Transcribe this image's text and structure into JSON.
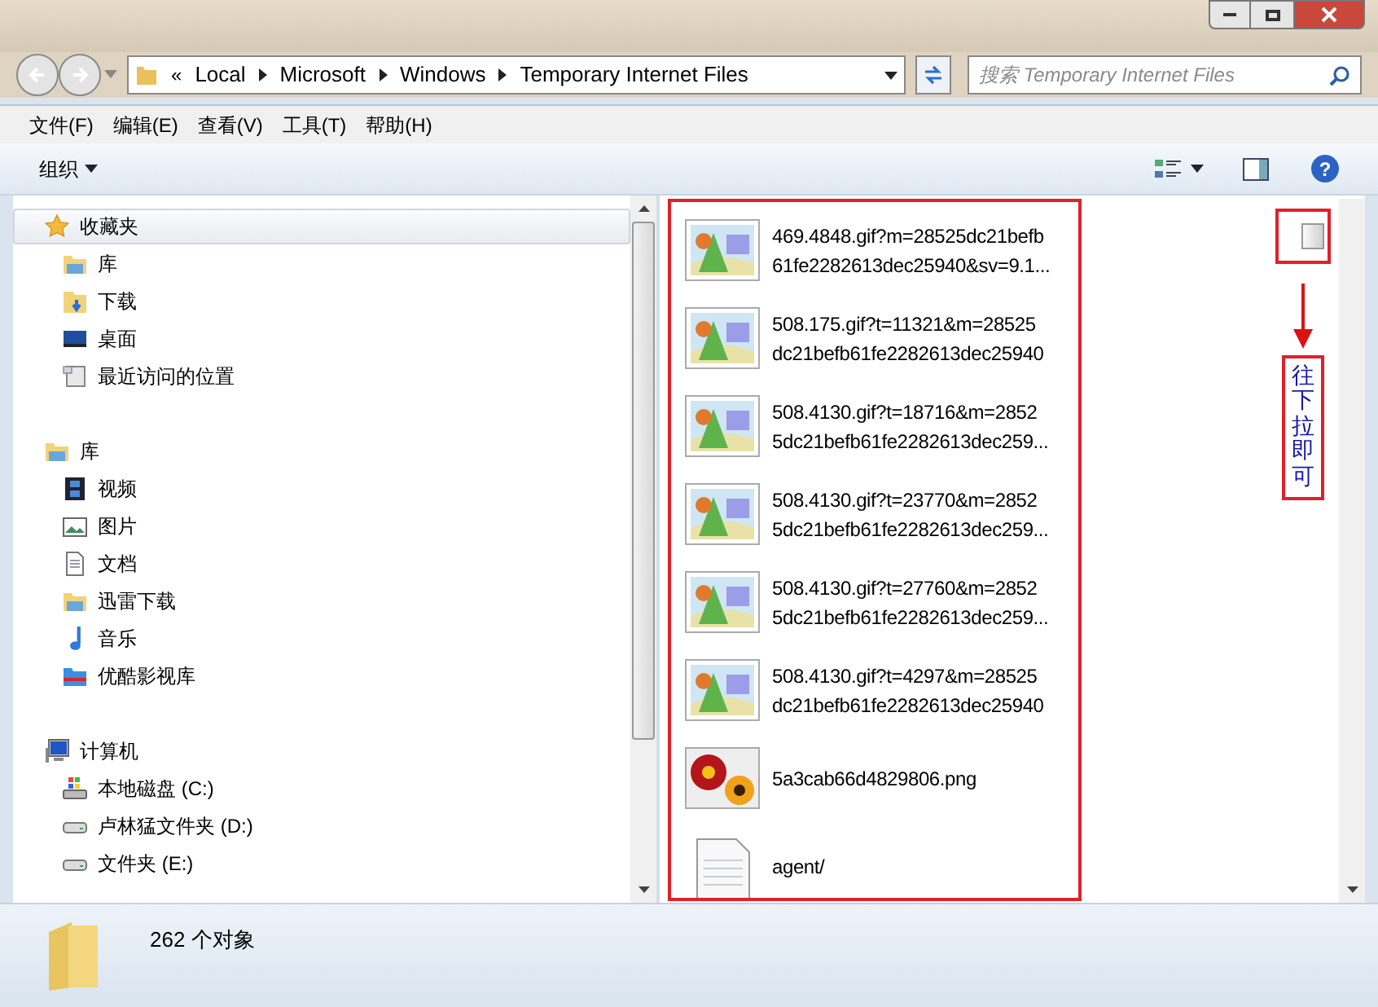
{
  "help": {
    "glyph": "?"
  },
  "address": {
    "overflow": "«",
    "crumbs": [
      "Local",
      "Microsoft",
      "Windows",
      "Temporary Internet Files"
    ]
  },
  "search": {
    "placeholder": "搜索 Temporary Internet Files"
  },
  "menu": [
    "文件(F)",
    "编辑(E)",
    "查看(V)",
    "工具(T)",
    "帮助(H)"
  ],
  "toolbar": {
    "organize": "组织"
  },
  "nav": [
    {
      "label": "收藏夹",
      "kind": "star",
      "selected": true,
      "children": [
        {
          "label": "库",
          "kind": "library"
        },
        {
          "label": "下载",
          "kind": "download"
        },
        {
          "label": "桌面",
          "kind": "desktop"
        },
        {
          "label": "最近访问的位置",
          "kind": "recent"
        }
      ]
    },
    {
      "label": "库",
      "kind": "library",
      "selected": false,
      "children": [
        {
          "label": "视频",
          "kind": "video"
        },
        {
          "label": "图片",
          "kind": "picture"
        },
        {
          "label": "文档",
          "kind": "document"
        },
        {
          "label": "迅雷下载",
          "kind": "library"
        },
        {
          "label": "音乐",
          "kind": "music"
        },
        {
          "label": "优酷影视库",
          "kind": "video-library"
        }
      ]
    },
    {
      "label": "计算机",
      "kind": "computer",
      "selected": false,
      "children": [
        {
          "label": "本地磁盘 (C:)",
          "kind": "system-drive"
        },
        {
          "label": "卢林猛文件夹 (D:)",
          "kind": "drive"
        },
        {
          "label": "文件夹 (E:)",
          "kind": "drive"
        }
      ]
    }
  ],
  "files": [
    {
      "name": "469.4848.gif?m=28525dc21befb\n61fe2282613dec25940&sv=9.1...",
      "kind": "image"
    },
    {
      "name": "508.175.gif?t=11321&m=28525\ndc21befb61fe2282613dec25940",
      "kind": "image"
    },
    {
      "name": "508.4130.gif?t=18716&m=2852\n5dc21befb61fe2282613dec259...",
      "kind": "image"
    },
    {
      "name": "508.4130.gif?t=23770&m=2852\n5dc21befb61fe2282613dec259...",
      "kind": "image"
    },
    {
      "name": "508.4130.gif?t=27760&m=2852\n5dc21befb61fe2282613dec259...",
      "kind": "image"
    },
    {
      "name": "508.4130.gif?t=4297&m=28525\ndc21befb61fe2282613dec25940",
      "kind": "image"
    },
    {
      "name": "5a3cab66d4829806.png",
      "kind": "photo"
    },
    {
      "name": "agent/",
      "kind": "text"
    }
  ],
  "annotation": {
    "text": "往下拉即可"
  },
  "status_bar": {
    "count": "262 个对象"
  }
}
